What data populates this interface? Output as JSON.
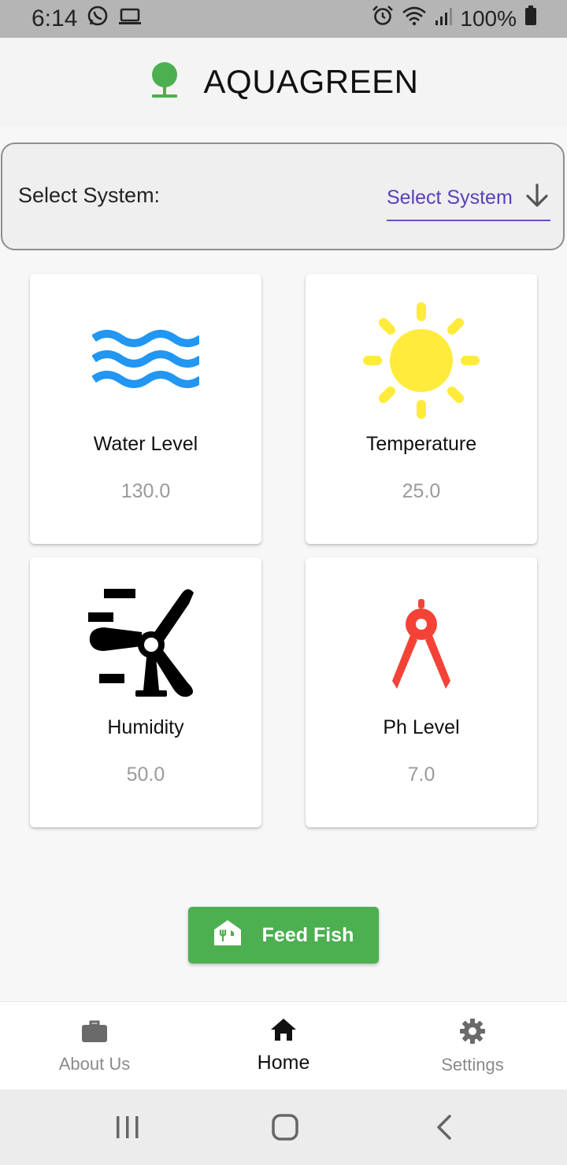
{
  "status_bar": {
    "time": "6:14",
    "battery": "100%",
    "icons": [
      "whatsapp-icon",
      "laptop-icon",
      "alarm-icon",
      "wifi-icon",
      "signal-icon",
      "battery-icon"
    ]
  },
  "app": {
    "title": "AQUAGREEN",
    "logo_icon": "tree-icon",
    "logo_color": "#4caf50"
  },
  "selector": {
    "label": "Select System:",
    "value": "Select System",
    "accent_color": "#5b3fb8"
  },
  "cards": [
    {
      "title": "Water Level",
      "value": "130.0",
      "icon": "water-waves-icon",
      "icon_color": "#2196f3"
    },
    {
      "title": "Temperature",
      "value": "25.0",
      "icon": "sun-icon",
      "icon_color": "#ffeb3b"
    },
    {
      "title": "Humidity",
      "value": "50.0",
      "icon": "wind-turbine-icon",
      "icon_color": "#000000"
    },
    {
      "title": "Ph Level",
      "value": "7.0",
      "icon": "compass-icon",
      "icon_color": "#f44336"
    }
  ],
  "feed_button": {
    "label": "Feed Fish",
    "icon": "feed-store-icon",
    "color": "#4caf50"
  },
  "bottom_nav": {
    "items": [
      {
        "label": "About Us",
        "icon": "briefcase-icon",
        "active": false
      },
      {
        "label": "Home",
        "icon": "home-icon",
        "active": true
      },
      {
        "label": "Settings",
        "icon": "gear-icon",
        "active": false
      }
    ]
  },
  "system_nav": {
    "icons": [
      "recent-apps-icon",
      "home-circle-icon",
      "back-icon"
    ]
  }
}
